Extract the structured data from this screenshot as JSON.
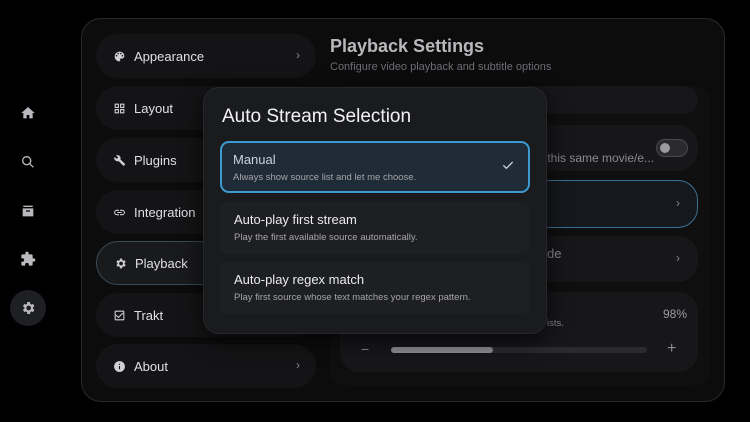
{
  "sidebar_rail": {
    "items": [
      {
        "icon": "home-icon"
      },
      {
        "icon": "search-icon"
      },
      {
        "icon": "library-icon"
      },
      {
        "icon": "puzzle-icon"
      },
      {
        "icon": "gear-icon",
        "active": true
      }
    ]
  },
  "settings_menu": {
    "items": [
      {
        "label": "Appearance",
        "icon": "palette-icon"
      },
      {
        "label": "Layout",
        "icon": "grid-icon"
      },
      {
        "label": "Plugins",
        "icon": "wrench-icon"
      },
      {
        "label": "Integration",
        "icon": "link-icon"
      },
      {
        "label": "Playback",
        "icon": "gear-icon",
        "active": true
      },
      {
        "label": "Trakt",
        "icon": "checkbox-icon"
      },
      {
        "label": "About",
        "icon": "info-icon"
      }
    ]
  },
  "content": {
    "title": "Playback Settings",
    "subtitle": "Configure video playback and subtitle options",
    "row_partial_text_1": "r this same movie/e...",
    "row_partial_text_2": "de",
    "row_partial_text_3": "ists.",
    "slider_value_text": "98%",
    "slider_value": 0.4,
    "minus_label": "−",
    "plus_label": "+"
  },
  "modal": {
    "title": "Auto Stream Selection",
    "options": [
      {
        "title": "Manual",
        "description": "Always show source list and let me choose.",
        "selected": true
      },
      {
        "title": "Auto-play first stream",
        "description": "Play the first available source automatically.",
        "selected": false
      },
      {
        "title": "Auto-play regex match",
        "description": "Play first source whose text matches your regex pattern.",
        "selected": false
      }
    ]
  },
  "colors": {
    "accent": "#3c9ad0",
    "background": "#000000",
    "modal_bg": "#1a1b1d"
  }
}
